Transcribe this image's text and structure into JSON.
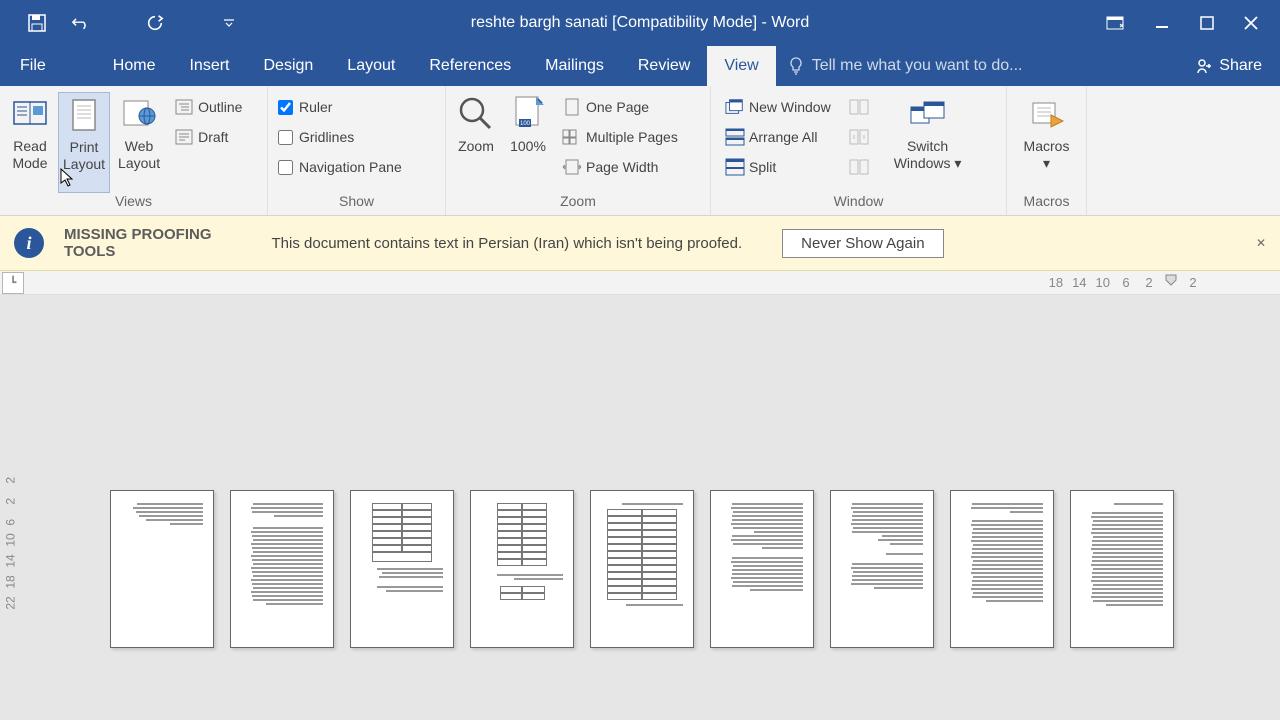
{
  "title": "reshte bargh sanati [Compatibility Mode] - Word",
  "tabs": {
    "file": "File",
    "home": "Home",
    "insert": "Insert",
    "design": "Design",
    "layout": "Layout",
    "references": "References",
    "mailings": "Mailings",
    "review": "Review",
    "view": "View"
  },
  "tellme_placeholder": "Tell me what you want to do...",
  "share": "Share",
  "ribbon": {
    "views": {
      "label": "Views",
      "read_mode": "Read\nMode",
      "print_layout": "Print\nLayout",
      "web_layout": "Web\nLayout",
      "outline": "Outline",
      "draft": "Draft"
    },
    "show": {
      "label": "Show",
      "ruler": "Ruler",
      "gridlines": "Gridlines",
      "navpane": "Navigation Pane"
    },
    "zoom": {
      "label": "Zoom",
      "zoom": "Zoom",
      "p100": "100%",
      "one_page": "One Page",
      "multi_pages": "Multiple Pages",
      "page_width": "Page Width"
    },
    "window": {
      "label": "Window",
      "new_window": "New Window",
      "arrange_all": "Arrange All",
      "split": "Split",
      "switch": "Switch\nWindows"
    },
    "macros": {
      "label": "Macros",
      "macros": "Macros"
    }
  },
  "warning": {
    "title_top": "MISSING PROOFING",
    "title_bottom": "TOOLS",
    "text": "This document contains text in Persian (Iran) which isn't being proofed.",
    "button": "Never Show Again"
  },
  "ruler_h": [
    "18",
    "14",
    "10",
    "6",
    "2",
    "2"
  ],
  "ruler_v": [
    "2",
    "2",
    "6",
    "10",
    "14",
    "18",
    "22"
  ]
}
